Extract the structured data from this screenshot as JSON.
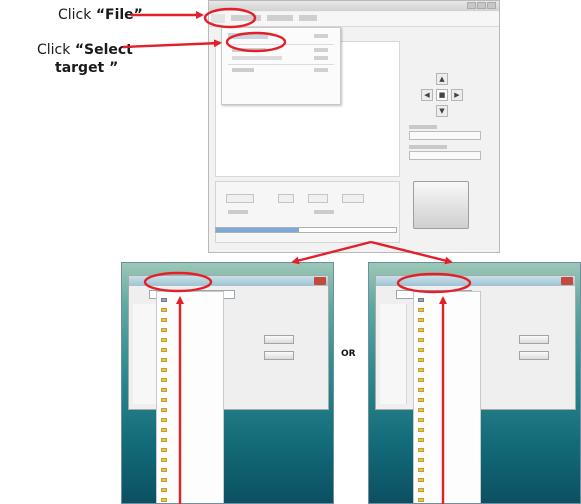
{
  "callouts": {
    "file": {
      "prefix": "Click ",
      "bold": "“File”"
    },
    "select_target": {
      "prefix": "Click ",
      "bold_line1": "“Select",
      "bold_line2": "target ”"
    }
  },
  "separator_label": "OR",
  "colors": {
    "annotation_red": "#e3202a",
    "desktop_teal": "#2f8a90"
  }
}
